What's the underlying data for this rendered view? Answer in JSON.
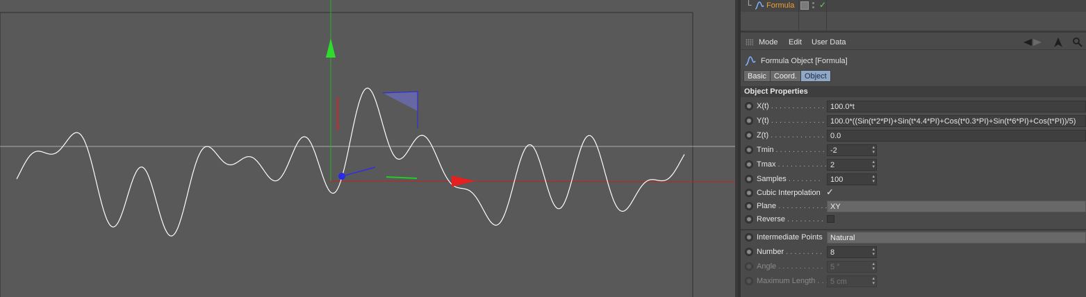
{
  "object_manager": {
    "object_name": "Formula",
    "object_icon": "formula-spline-icon",
    "tag_icon": "phong-tag-icon",
    "enabled_icon": "checkmark-icon"
  },
  "attributes": {
    "menu": [
      "Mode",
      "Edit",
      "User Data"
    ],
    "object_title": "Formula Object [Formula]",
    "tabs": [
      {
        "label": "Basic",
        "active": false
      },
      {
        "label": "Coord.",
        "active": false
      },
      {
        "label": "Object",
        "active": true
      }
    ],
    "section_title": "Object Properties",
    "properties": {
      "xt": {
        "label": "X(t)",
        "value": "100.0*t"
      },
      "yt": {
        "label": "Y(t)",
        "value": "100.0*((Sin(t*2*PI)+Sin(t*4.4*PI)+Cos(t*0.3*PI)+Sin(t*6*PI)+Cos(t*PI))/5)"
      },
      "zt": {
        "label": "Z(t)",
        "value": "0.0"
      },
      "tmin": {
        "label": "Tmin",
        "value": "-2"
      },
      "tmax": {
        "label": "Tmax",
        "value": "2"
      },
      "samples": {
        "label": "Samples",
        "value": "100"
      },
      "cubic": {
        "label": "Cubic Interpolation",
        "checked": true
      },
      "plane": {
        "label": "Plane",
        "value": "XY"
      },
      "reverse": {
        "label": "Reverse",
        "checked": false
      },
      "intermediate": {
        "label": "Intermediate Points",
        "value": "Natural"
      },
      "number": {
        "label": "Number",
        "value": "8"
      },
      "angle": {
        "label": "Angle",
        "value": "5 °"
      },
      "maxlength": {
        "label": "Maximum Length",
        "value": "5 cm"
      }
    }
  },
  "colors": {
    "viewport_bg": "#595959",
    "curve": "#ffffff",
    "axis_x": "#e02020",
    "axis_y": "#20d020",
    "axis_z": "#2020e0",
    "object_name": "#f0a030",
    "active_tab": "#8fa8c8"
  }
}
